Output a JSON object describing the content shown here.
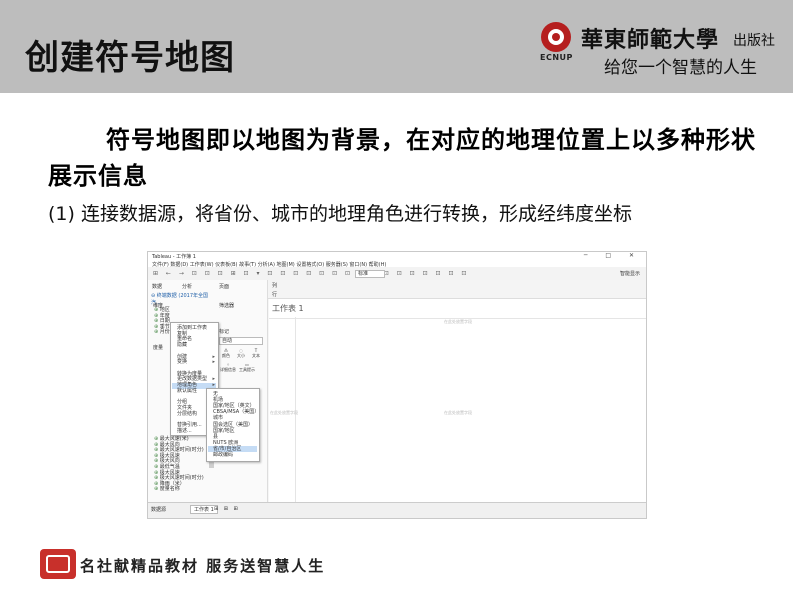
{
  "header": {
    "title": "创建符号地图",
    "university": "華東師範大學",
    "press": "出版社",
    "logo_abbr": "ECNUP",
    "slogan": "给您一个智慧的人生"
  },
  "body": {
    "paragraph1": "符号地图即以地图为背景，在对应的地理位置上以多种形状展示信息",
    "paragraph2": "(1) 连接数据源，将省份、城市的地理角色进行转换，形成经纬度坐标"
  },
  "screenshot": {
    "window_title": "Tableau - 工作簿 1",
    "window_controls": "─ □ ✕",
    "menubar": "文件(F)  数据(D)  工作表(W)  仪表板(B)  故事(T)  分析(A)  地图(M)  设置格式(O)  服务器(S)  窗口(N)  帮助(H)",
    "toolbar_icons": "⊞ ← → ⊡ ⊡ ⊡ ⊞ ⊡ ▾ ⊡ ⊡ ⊡ ⊡ ⊡ ⊡ ⊡ ⊡ ⊡ ⊡ ⊡ ⊡ ⊡ ⊡ ⊡ ⊡",
    "toolbar_select": "标准",
    "show_me": "智能显示",
    "data_tab": "数据",
    "analysis_tab": "分析",
    "data_source": "⊖ 终端数据 (2017年全国汽...",
    "dimensions_header": "维度",
    "measures_header": "度量",
    "fields_top": [
      "地区",
      "年度",
      "日期",
      "季节",
      "月份"
    ],
    "fields_bottom": [
      "最大风速(米)",
      "最大风向",
      "最大风速时间(时分)",
      "极大风速",
      "极大风向",
      "最低气温",
      "极大风速",
      "极大风速时间(时分)",
      "降雨（米）",
      "度量名称"
    ],
    "pages_label": "页面",
    "filters_label": "筛选器",
    "marks_label": "标记",
    "marks_type": "自动",
    "mark_buttons": [
      "颜色",
      "大小",
      "文本",
      "详细信息",
      "工具提示"
    ],
    "columns_label": "列",
    "rows_label": "行",
    "sheet_title": "工作表 1",
    "drop_field_top": "在此处放置字段",
    "drop_field_left": "在此处放置字段",
    "drop_field_center": "在此处放置字段",
    "status_source": "数据源",
    "status_sheet": "工作表 1",
    "status_icons": "⊞ ⊞ ⊞",
    "context_menu": [
      {
        "label": "添加到工作表",
        "arrow": ""
      },
      {
        "label": "复制",
        "arrow": ""
      },
      {
        "label": "重命名",
        "arrow": ""
      },
      {
        "label": "隐藏",
        "arrow": ""
      },
      {
        "label": "",
        "arrow": ""
      },
      {
        "label": "创建",
        "arrow": "▸"
      },
      {
        "label": "变换",
        "arrow": "▸"
      },
      {
        "label": "",
        "arrow": ""
      },
      {
        "label": "转换为度量",
        "arrow": ""
      },
      {
        "label": "更改数据类型",
        "arrow": "▸"
      },
      {
        "label": "地理角色",
        "arrow": "▸"
      },
      {
        "label": "默认属性",
        "arrow": "▸"
      },
      {
        "label": "",
        "arrow": ""
      },
      {
        "label": "分组",
        "arrow": "▸"
      },
      {
        "label": "文件夹",
        "arrow": "▸"
      },
      {
        "label": "分层结构",
        "arrow": "▸"
      },
      {
        "label": "",
        "arrow": ""
      },
      {
        "label": "替换引用...",
        "arrow": ""
      },
      {
        "label": "描述...",
        "arrow": ""
      }
    ],
    "geo_submenu": [
      "无",
      "机场",
      "国家/地区（英文）",
      "CBSA/MSA（美国）",
      "城市",
      "国会选区（美国）",
      "国家/地区",
      "县",
      "NUTS 欧洲",
      "省/市/自治区",
      "邮政编码"
    ]
  },
  "footer": {
    "text": "名社献精品教材  服务送智慧人生"
  }
}
